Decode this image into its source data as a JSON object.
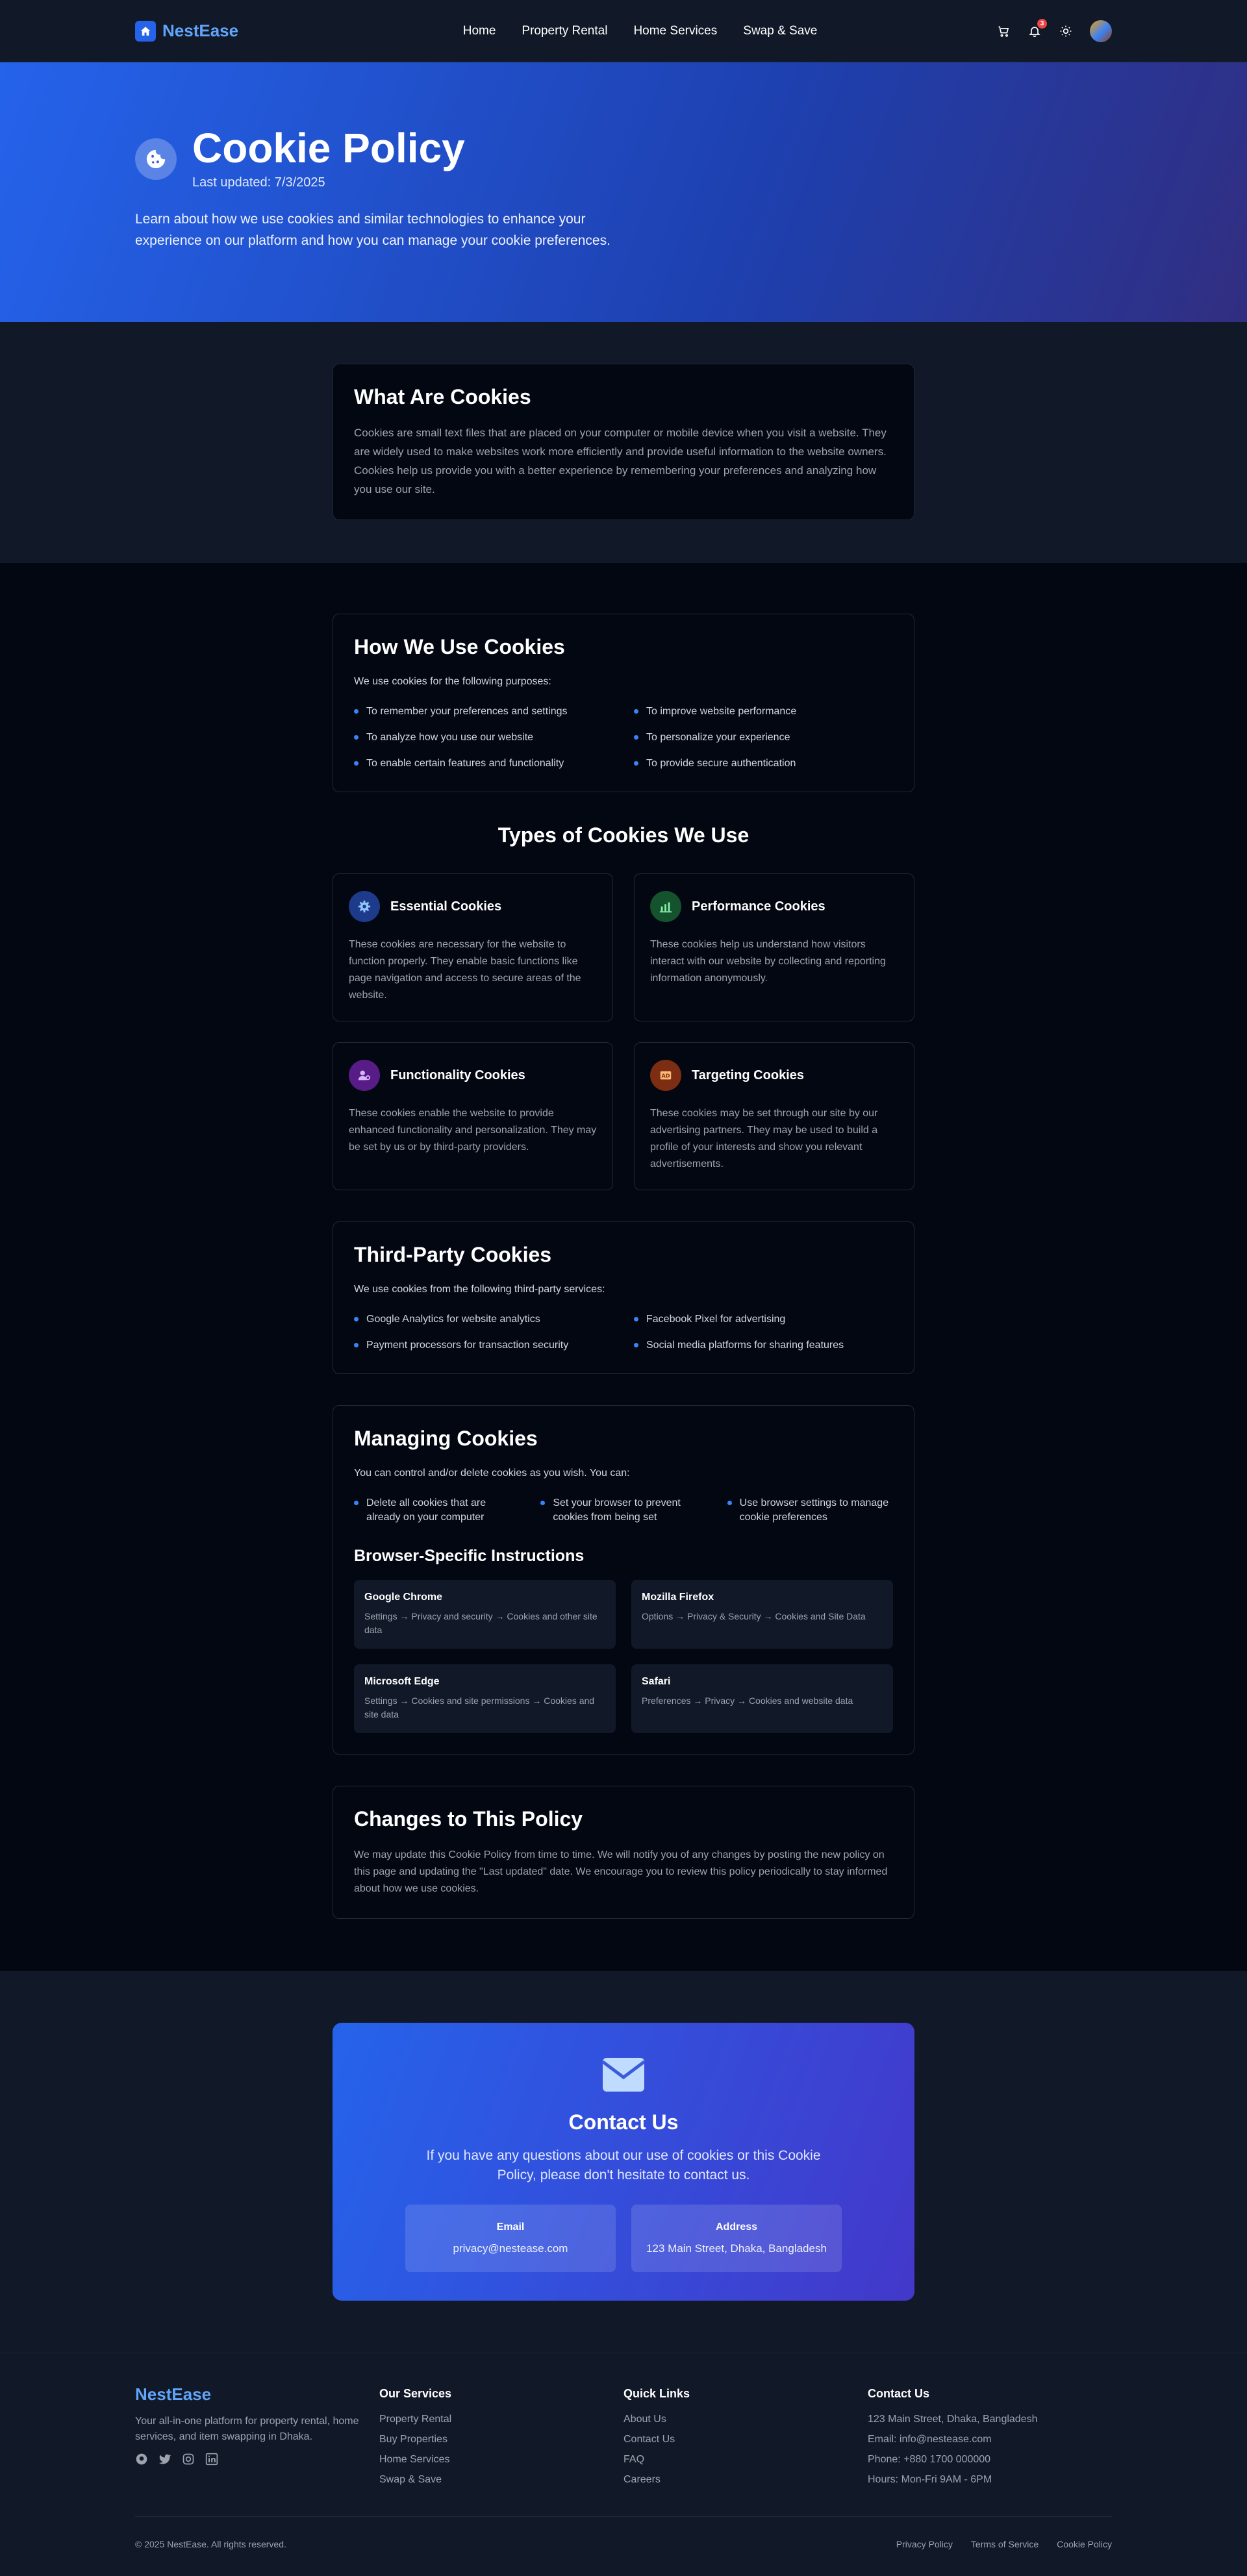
{
  "nav": {
    "brand": "NestEase",
    "links": [
      "Home",
      "Property Rental",
      "Home Services",
      "Swap & Save"
    ],
    "notification_count": "3",
    "icons": [
      "cart-icon",
      "bell-icon",
      "sun-icon",
      "avatar"
    ]
  },
  "hero": {
    "title": "Cookie Policy",
    "updated": "Last updated: 7/3/2025",
    "description": "Learn about how we use cookies and similar technologies to enhance your experience on our platform and how you can manage your cookie preferences."
  },
  "what": {
    "title": "What Are Cookies",
    "text": "Cookies are small text files that are placed on your computer or mobile device when you visit a website. They are widely used to make websites work more efficiently and provide useful information to the website owners. Cookies help us provide you with a better experience by remembering your preferences and analyzing how you use our site."
  },
  "how": {
    "title": "How We Use Cookies",
    "intro": "We use cookies for the following purposes:",
    "items": [
      "To remember your preferences and settings",
      "To improve website performance",
      "To analyze how you use our website",
      "To personalize your experience",
      "To enable certain features and functionality",
      "To provide secure authentication"
    ]
  },
  "types": {
    "title": "Types of Cookies We Use",
    "cards": [
      {
        "name": "Essential Cookies",
        "icon": "gear-icon",
        "color": "#1e40af",
        "desc": "These cookies are necessary for the website to function properly. They enable basic functions like page navigation and access to secure areas of the website."
      },
      {
        "name": "Performance Cookies",
        "icon": "chart-icon",
        "color": "#166534",
        "desc": "These cookies help us understand how visitors interact with our website by collecting and reporting information anonymously."
      },
      {
        "name": "Functionality Cookies",
        "icon": "user-gear-icon",
        "color": "#6b21a8",
        "desc": "These cookies enable the website to provide enhanced functionality and personalization. They may be set by us or by third-party providers."
      },
      {
        "name": "Targeting Cookies",
        "icon": "ad-icon",
        "color": "#9a3412",
        "desc": "These cookies may be set through our site by our advertising partners. They may be used to build a profile of your interests and show you relevant advertisements."
      }
    ]
  },
  "third": {
    "title": "Third-Party Cookies",
    "intro": "We use cookies from the following third-party services:",
    "items": [
      "Google Analytics for website analytics",
      "Facebook Pixel for advertising",
      "Payment processors for transaction security",
      "Social media platforms for sharing features"
    ]
  },
  "managing": {
    "title": "Managing Cookies",
    "intro": "You can control and/or delete cookies as you wish. You can:",
    "items": [
      "Delete all cookies that are already on your computer",
      "Set your browser to prevent cookies from being set",
      "Use browser settings to manage cookie preferences"
    ],
    "browser_title": "Browser-Specific Instructions",
    "browsers": [
      {
        "name": "Google Chrome",
        "path": "Settings → Privacy and security → Cookies and other site data"
      },
      {
        "name": "Mozilla Firefox",
        "path": "Options → Privacy & Security → Cookies and Site Data"
      },
      {
        "name": "Microsoft Edge",
        "path": "Settings → Cookies and site permissions → Cookies and site data"
      },
      {
        "name": "Safari",
        "path": "Preferences → Privacy → Cookies and website data"
      }
    ]
  },
  "changes": {
    "title": "Changes to This Policy",
    "text": "We may update this Cookie Policy from time to time. We will notify you of any changes by posting the new policy on this page and updating the \"Last updated\" date. We encourage you to review this policy periodically to stay informed about how we use cookies."
  },
  "contact": {
    "title": "Contact Us",
    "description": "If you have any questions about our use of cookies or this Cookie Policy, please don't hesitate to contact us.",
    "email_label": "Email",
    "email_value": "privacy@nestease.com",
    "address_label": "Address",
    "address_value": "123 Main Street, Dhaka, Bangladesh"
  },
  "footer": {
    "brand": "NestEase",
    "tagline": "Your all-in-one platform for property rental, home services, and item swapping in Dhaka.",
    "services_title": "Our Services",
    "services": [
      "Property Rental",
      "Buy Properties",
      "Home Services",
      "Swap & Save"
    ],
    "links_title": "Quick Links",
    "links": [
      "About Us",
      "Contact Us",
      "FAQ",
      "Careers"
    ],
    "contact_title": "Contact Us",
    "contact": [
      "123 Main Street, Dhaka, Bangladesh",
      "Email: info@nestease.com",
      "Phone: +880 1700 000000",
      "Hours: Mon-Fri 9AM - 6PM"
    ],
    "copyright": "© 2025 NestEase. All rights reserved.",
    "legal": [
      "Privacy Policy",
      "Terms of Service",
      "Cookie Policy"
    ]
  }
}
